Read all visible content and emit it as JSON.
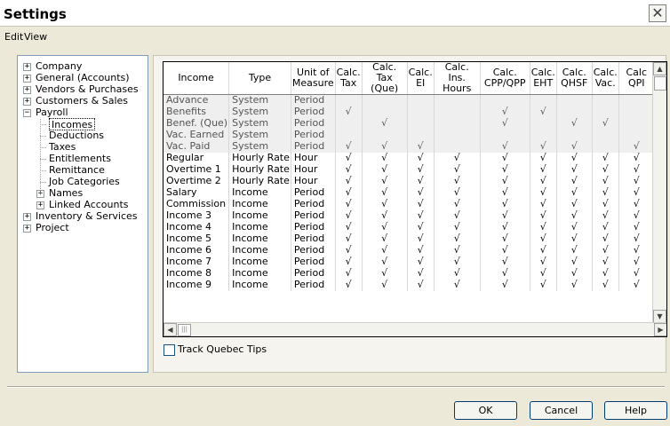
{
  "window": {
    "title": "Settings",
    "close_glyph": "✕"
  },
  "menu": {
    "edit": "Edit",
    "view": "View"
  },
  "tree": [
    {
      "label": "Company",
      "expander": "+",
      "level": 0
    },
    {
      "label": "General (Accounts)",
      "expander": "+",
      "level": 0
    },
    {
      "label": "Vendors & Purchases",
      "expander": "+",
      "level": 0
    },
    {
      "label": "Customers & Sales",
      "expander": "+",
      "level": 0
    },
    {
      "label": "Payroll",
      "expander": "−",
      "level": 0
    },
    {
      "label": "Incomes",
      "expander": "",
      "level": 1,
      "selected": true
    },
    {
      "label": "Deductions",
      "expander": "",
      "level": 1
    },
    {
      "label": "Taxes",
      "expander": "",
      "level": 1
    },
    {
      "label": "Entitlements",
      "expander": "",
      "level": 1
    },
    {
      "label": "Remittance",
      "expander": "",
      "level": 1
    },
    {
      "label": "Job Categories",
      "expander": "",
      "level": 1
    },
    {
      "label": "Names",
      "expander": "+",
      "level": 1
    },
    {
      "label": "Linked Accounts",
      "expander": "+",
      "level": 1
    },
    {
      "label": "Inventory & Services",
      "expander": "+",
      "level": 0
    },
    {
      "label": "Project",
      "expander": "+",
      "level": 0
    }
  ],
  "grid": {
    "check_glyph": "√",
    "columns": [
      {
        "l1": "Income",
        "l2": ""
      },
      {
        "l1": "Type",
        "l2": ""
      },
      {
        "l1": "Unit of",
        "l2": "Measure"
      },
      {
        "l1": "Calc.",
        "l2": "Tax"
      },
      {
        "l1": "Calc.",
        "l2": "Tax (Que)"
      },
      {
        "l1": "Calc.",
        "l2": "EI"
      },
      {
        "l1": "Calc.",
        "l2": "Ins. Hours"
      },
      {
        "l1": "Calc.",
        "l2": "CPP/QPP"
      },
      {
        "l1": "Calc.",
        "l2": "EHT"
      },
      {
        "l1": "Calc.",
        "l2": "QHSF"
      },
      {
        "l1": "Calc.",
        "l2": "Vac."
      },
      {
        "l1": "Calc",
        "l2": "QPI"
      }
    ],
    "rows": [
      {
        "income": "Advance",
        "type": "System",
        "unit": "Period",
        "sys": true,
        "checks": [
          0,
          0,
          0,
          0,
          0,
          0,
          0,
          0,
          0
        ]
      },
      {
        "income": "Benefits",
        "type": "System",
        "unit": "Period",
        "sys": true,
        "checks": [
          1,
          0,
          0,
          0,
          1,
          1,
          0,
          0,
          0
        ]
      },
      {
        "income": "Benef. (Que)",
        "type": "System",
        "unit": "Period",
        "sys": true,
        "checks": [
          0,
          1,
          0,
          0,
          1,
          0,
          1,
          1,
          0
        ]
      },
      {
        "income": "Vac. Earned",
        "type": "System",
        "unit": "Period",
        "sys": true,
        "checks": [
          0,
          0,
          0,
          0,
          0,
          0,
          0,
          0,
          0
        ]
      },
      {
        "income": "Vac. Paid",
        "type": "System",
        "unit": "Period",
        "sys": true,
        "checks": [
          1,
          1,
          1,
          0,
          1,
          1,
          1,
          0,
          1
        ]
      },
      {
        "income": "Regular",
        "type": "Hourly Rate",
        "unit": "Hour",
        "sys": false,
        "checks": [
          1,
          1,
          1,
          1,
          1,
          1,
          1,
          1,
          1
        ]
      },
      {
        "income": "Overtime 1",
        "type": "Hourly Rate",
        "unit": "Hour",
        "sys": false,
        "checks": [
          1,
          1,
          1,
          1,
          1,
          1,
          1,
          1,
          1
        ]
      },
      {
        "income": "Overtime 2",
        "type": "Hourly Rate",
        "unit": "Hour",
        "sys": false,
        "checks": [
          1,
          1,
          1,
          1,
          1,
          1,
          1,
          1,
          1
        ]
      },
      {
        "income": "Salary",
        "type": "Income",
        "unit": "Period",
        "sys": false,
        "checks": [
          1,
          1,
          1,
          1,
          1,
          1,
          1,
          1,
          1
        ]
      },
      {
        "income": "Commission",
        "type": "Income",
        "unit": "Period",
        "sys": false,
        "checks": [
          1,
          1,
          1,
          1,
          1,
          1,
          1,
          1,
          1
        ]
      },
      {
        "income": "Income 3",
        "type": "Income",
        "unit": "Period",
        "sys": false,
        "checks": [
          1,
          1,
          1,
          1,
          1,
          1,
          1,
          1,
          1
        ]
      },
      {
        "income": "Income 4",
        "type": "Income",
        "unit": "Period",
        "sys": false,
        "checks": [
          1,
          1,
          1,
          1,
          1,
          1,
          1,
          1,
          1
        ]
      },
      {
        "income": "Income 5",
        "type": "Income",
        "unit": "Period",
        "sys": false,
        "checks": [
          1,
          1,
          1,
          1,
          1,
          1,
          1,
          1,
          1
        ]
      },
      {
        "income": "Income 6",
        "type": "Income",
        "unit": "Period",
        "sys": false,
        "checks": [
          1,
          1,
          1,
          1,
          1,
          1,
          1,
          1,
          1
        ]
      },
      {
        "income": "Income 7",
        "type": "Income",
        "unit": "Period",
        "sys": false,
        "checks": [
          1,
          1,
          1,
          1,
          1,
          1,
          1,
          1,
          1
        ]
      },
      {
        "income": "Income 8",
        "type": "Income",
        "unit": "Period",
        "sys": false,
        "checks": [
          1,
          1,
          1,
          1,
          1,
          1,
          1,
          1,
          1
        ]
      },
      {
        "income": "Income 9",
        "type": "Income",
        "unit": "Period",
        "sys": false,
        "checks": [
          1,
          1,
          1,
          1,
          1,
          1,
          1,
          1,
          1
        ]
      }
    ]
  },
  "track_quebec_tips": {
    "label": "Track Quebec Tips",
    "checked": false
  },
  "buttons": {
    "ok": "OK",
    "cancel": "Cancel",
    "help": "Help"
  }
}
